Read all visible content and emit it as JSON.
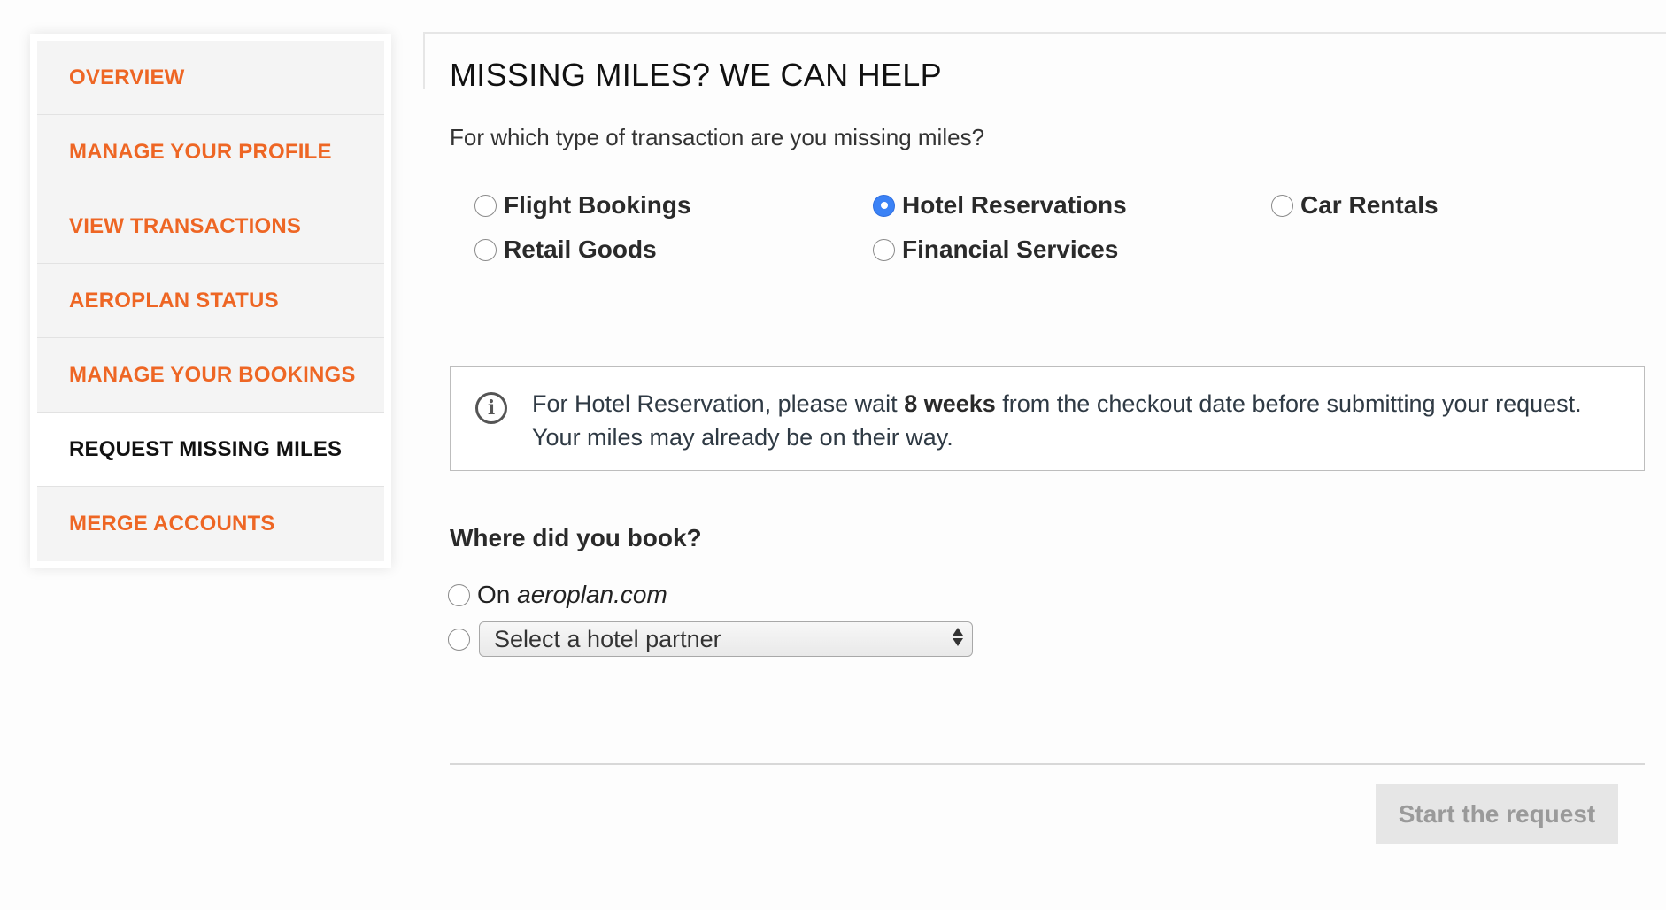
{
  "sidebar": {
    "items": [
      {
        "label": "OVERVIEW",
        "active": false
      },
      {
        "label": "MANAGE YOUR PROFILE",
        "active": false
      },
      {
        "label": "VIEW TRANSACTIONS",
        "active": false
      },
      {
        "label": "AEROPLAN STATUS",
        "active": false
      },
      {
        "label": "MANAGE YOUR BOOKINGS",
        "active": false
      },
      {
        "label": "REQUEST MISSING MILES",
        "active": true
      },
      {
        "label": "MERGE ACCOUNTS",
        "active": false
      }
    ]
  },
  "main": {
    "title": "MISSING MILES? WE CAN HELP",
    "question": "For which type of transaction are you missing miles?",
    "transaction_types": {
      "flight": {
        "label": "Flight Bookings",
        "selected": false
      },
      "hotel": {
        "label": "Hotel Reservations",
        "selected": true
      },
      "car": {
        "label": "Car Rentals",
        "selected": false
      },
      "retail": {
        "label": "Retail Goods",
        "selected": false
      },
      "financial": {
        "label": "Financial Services",
        "selected": false
      }
    },
    "info": {
      "text_before": "For Hotel Reservation, please wait ",
      "emphasis": "8 weeks",
      "text_after": " from the checkout date before submitting your request. Your miles may already be on their way.",
      "icon": "info-icon"
    },
    "where_heading": "Where did you book?",
    "book_options": {
      "on_prefix": "On ",
      "on_site": "aeroplan.com",
      "partner_select_value": "Select a hotel partner"
    },
    "start_button": "Start the request"
  },
  "colors": {
    "accent_orange": "#ee6624",
    "radio_selected": "#3b82f6",
    "disabled_button_bg": "#e6e6e6",
    "disabled_button_text": "#9a9a9a"
  }
}
